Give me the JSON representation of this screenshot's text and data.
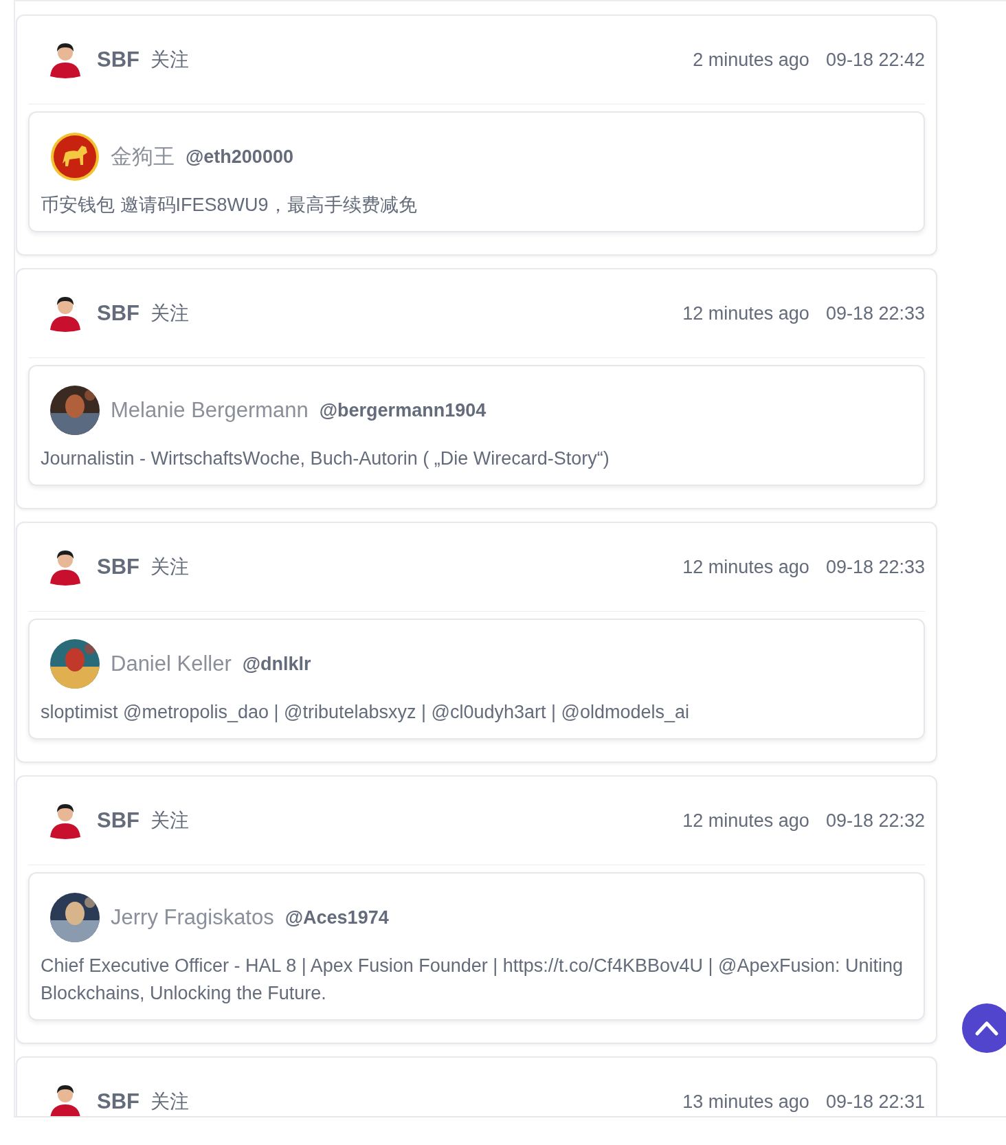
{
  "posts": [
    {
      "author": "SBF",
      "follow_label": "关注",
      "relative_time": "2 minutes ago",
      "timestamp": "09-18 22:42",
      "quoted": {
        "avatar": {
          "kind": "logo"
        },
        "name": "金狗王",
        "handle": "@eth200000",
        "bio": "币安钱包 邀请码IFES8WU9，最高手续费减免"
      }
    },
    {
      "author": "SBF",
      "follow_label": "关注",
      "relative_time": "12 minutes ago",
      "timestamp": "09-18 22:33",
      "quoted": {
        "name": "Melanie Bergermann",
        "handle": "@bergermann1904",
        "bio": "Journalistin - WirtschaftsWoche, Buch-Autorin ( „Die Wirecard-Story“)"
      }
    },
    {
      "author": "SBF",
      "follow_label": "关注",
      "relative_time": "12 minutes ago",
      "timestamp": "09-18 22:33",
      "quoted": {
        "name": "Daniel Keller",
        "handle": "@dnlklr",
        "bio": "sloptimist @metropolis_dao | @tributelabsxyz | @cl0udyh3art | @oldmodels_ai"
      }
    },
    {
      "author": "SBF",
      "follow_label": "关注",
      "relative_time": "12 minutes ago",
      "timestamp": "09-18 22:32",
      "quoted": {
        "name": "Jerry Fragiskatos",
        "handle": "@Aces1974",
        "bio": "Chief Executive Officer - HAL 8 | Apex Fusion Founder | https://t.co/Cf4KBBov4U | @ApexFusion: Uniting Blockchains, Unlocking the Future."
      }
    },
    {
      "author": "SBF",
      "follow_label": "关注",
      "relative_time": "13 minutes ago",
      "timestamp": "09-18 22:31"
    }
  ]
}
